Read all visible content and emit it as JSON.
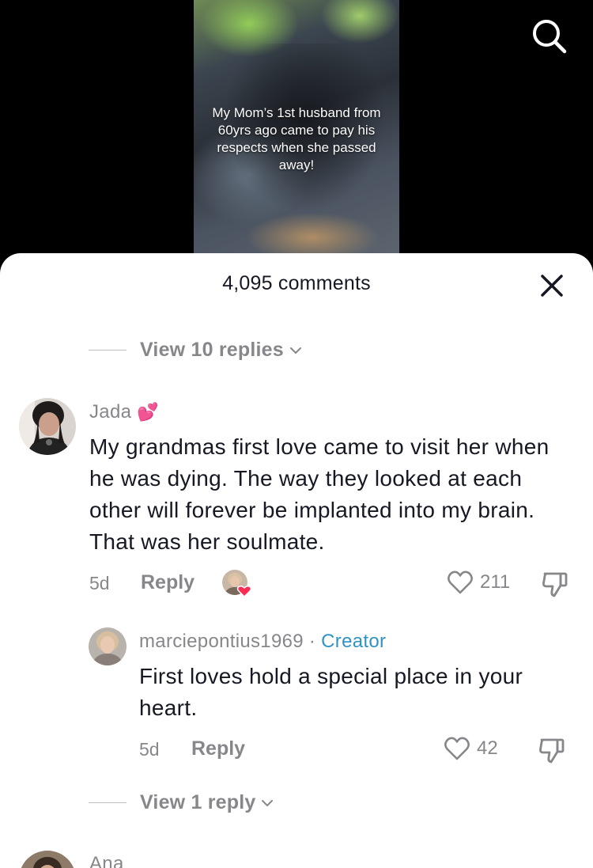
{
  "video": {
    "caption": "My Mom’s 1st husband from 60yrs ago came to pay his respects when she passed away!"
  },
  "header": {
    "comments_title": "4,095 comments"
  },
  "icons": {
    "search": "search-icon",
    "close": "close-icon",
    "heart": "heart-outline-icon",
    "dislike": "thumbs-down-icon",
    "chevron": "chevron-down-icon",
    "emoji": "two-hearts-emoji"
  },
  "colors": {
    "creator_accent": "#2f93c6",
    "muted_text": "#86878b",
    "primary_text": "#161823",
    "liked_heart": "#fe2c55"
  },
  "view_replies_top": "View 10 replies",
  "comments": [
    {
      "username": "Jada",
      "username_emoji": "💕",
      "text": "My grandmas first love came to visit her when he was dying. The way they looked at each other will forever be implanted into my brain. That was her soulmate.",
      "age": "5d",
      "reply_label": "Reply",
      "likes": "211",
      "replies": [
        {
          "username": "marciepontius1969",
          "separator": "·",
          "badge": "Creator",
          "text": "First loves hold a special place in your heart.",
          "age": "5d",
          "reply_label": "Reply",
          "likes": "42"
        }
      ],
      "view_more_replies": "View 1 reply"
    },
    {
      "username": "Ana"
    }
  ]
}
